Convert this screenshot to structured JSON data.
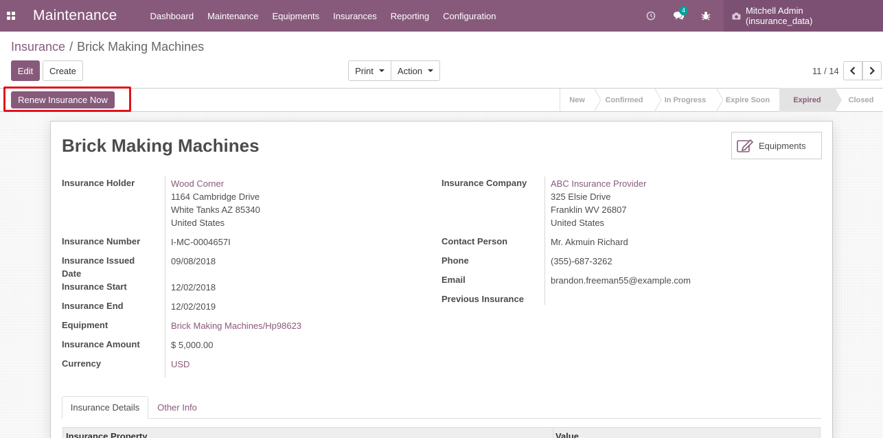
{
  "navbar": {
    "app_title": "Maintenance",
    "menu": [
      "Dashboard",
      "Maintenance",
      "Equipments",
      "Insurances",
      "Reporting",
      "Configuration"
    ],
    "messages_count": "4",
    "user": "Mitchell Admin (insurance_data)"
  },
  "breadcrumb": {
    "parent": "Insurance",
    "separator": "/",
    "current": "Brick Making Machines"
  },
  "toolbar": {
    "edit_label": "Edit",
    "create_label": "Create",
    "print_label": "Print",
    "action_label": "Action",
    "pager": "11 / 14"
  },
  "statusbar": {
    "renew_label": "Renew Insurance Now",
    "stages": [
      "New",
      "Confirmed",
      "In Progress",
      "Expire Soon",
      "Expired",
      "Closed"
    ],
    "active_stage": "Expired"
  },
  "record": {
    "title": "Brick Making Machines",
    "smart_button": "Equipments",
    "left": {
      "holder_label": "Insurance Holder",
      "holder_name": "Wood Corner",
      "holder_street": "1164 Cambridge Drive",
      "holder_city": "White Tanks AZ 85340",
      "holder_country": "United States",
      "number_label": "Insurance Number",
      "number_value": "I-MC-0004657I",
      "issued_label_1": "Insurance Issued",
      "issued_label_2": "Date",
      "issued_value": "09/08/2018",
      "start_label": "Insurance Start",
      "start_value": "12/02/2018",
      "end_label": "Insurance End",
      "end_value": "12/02/2019",
      "equipment_label": "Equipment",
      "equipment_value": "Brick Making Machines/Hp98623",
      "amount_label": "Insurance Amount",
      "amount_value": "$ 5,000.00",
      "currency_label": "Currency",
      "currency_value": "USD"
    },
    "right": {
      "company_label": "Insurance Company",
      "company_name": "ABC Insurance Provider",
      "company_street": "325 Elsie Drive",
      "company_city": "Franklin WV 26807",
      "company_country": "United States",
      "contact_label": "Contact Person",
      "contact_value": "Mr. Akmuin Richard",
      "phone_label": "Phone",
      "phone_value": "(355)-687-3262",
      "email_label": "Email",
      "email_value": "brandon.freeman55@example.com",
      "previous_label": "Previous Insurance",
      "previous_value": ""
    },
    "tabs": [
      "Insurance Details",
      "Other Info"
    ],
    "table_headers": [
      "Insurance Property",
      "Value"
    ]
  },
  "colors": {
    "brand": "#875a7b",
    "highlight": "#e4101b"
  }
}
